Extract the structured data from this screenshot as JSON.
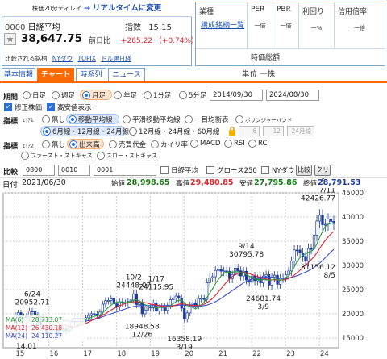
{
  "notice": {
    "small": "株価20分ディレイ",
    "arrow": "→",
    "big": "リアルタイムに変更"
  },
  "quote": {
    "code": "0000",
    "name": "日経平均",
    "index_label": "指数",
    "time": "15:15",
    "price": "38,647.75",
    "prev_label": "前日比",
    "change": "+285.22",
    "change_pct": "（+0.74%）",
    "compared_label": "比較される銘柄",
    "compared_links": [
      "NYダウ",
      "TOPIX",
      "ドル建日経"
    ]
  },
  "info": {
    "industry_label": "業種",
    "industry_value": "構成銘柄一覧",
    "per_label": "PER",
    "per_value": "一倍",
    "pbr_label": "PBR",
    "pbr_value": "一倍",
    "yield_label": "利回り",
    "yield_value": "一%",
    "credit_label": "信用倍率",
    "credit_value": "一倍",
    "mcap_label": "時価総額",
    "unit": "単位 一株"
  },
  "tabs": [
    "基本情報",
    "チャート",
    "時系列",
    "ニュース"
  ],
  "settings": {
    "period_label": "期間",
    "periods": [
      "日足",
      "週足",
      "月足",
      "年足",
      "1分足",
      "5分足"
    ],
    "selected_period": "月足",
    "date_from": "2014/09/30",
    "date_to": "2024/08/30",
    "adjusted_label": "修正株価",
    "highlow_label": "高安値表示",
    "indicator_label": "指標",
    "area1_label": "ｴﾘｱ1",
    "area1_opts": [
      "無し",
      "移動平均線",
      "平滑移動平均線",
      "一目均衡表",
      "ボリンジャーバンド"
    ],
    "ma_opts": [
      "6月線・12月線・24月線",
      "12月線・24月線・60月線"
    ],
    "ma_inputs": [
      "6",
      "12",
      "24月線"
    ],
    "area2_label": "ｴﾘｱ2",
    "area2_opts": [
      "無し",
      "出来高",
      "売買代金",
      "カイリ率",
      "MACD",
      "RSI",
      "RCI"
    ],
    "area2_opts_b": [
      "ファースト・ストキャス",
      "スロー・ストキャス"
    ],
    "compare_label": "比較",
    "compare_inputs": [
      "0800",
      "0010",
      "0001"
    ],
    "compare_checks": [
      "日経平均",
      "グロース250",
      "NYダウ"
    ],
    "compare_btn": "比較",
    "clear_btn": "クリア"
  },
  "header": {
    "date_label": "日付",
    "date": "2021/06/30",
    "open_label": "始値",
    "open": "28,998.65",
    "high_label": "高値",
    "high": "29,480.85",
    "low_label": "安値",
    "low": "27,795.86",
    "close_label": "終値",
    "close": "28,791.53"
  },
  "colors": {
    "up": "#1a7a1a",
    "high": "#e2242e",
    "down": "#1c3c99",
    "accent": "#ff6a00",
    "link": "#1c4fb1"
  },
  "chart_data": {
    "type": "candlestick",
    "x_ticks": [
      "15",
      "16",
      "17",
      "18",
      "19",
      "20",
      "21",
      "22",
      "23",
      "24"
    ],
    "ylim": [
      13000,
      45000
    ],
    "y_ticks": [
      15000,
      20000,
      25000,
      30000,
      35000,
      40000,
      45000
    ],
    "closes": [
      16173,
      17388,
      19747,
      20235,
      19034,
      19520,
      19207,
      20585,
      20563,
      19747,
      18890,
      17519,
      17518,
      16027,
      16759,
      16667,
      17235,
      15576,
      16569,
      16887,
      16450,
      17425,
      18308,
      19114,
      19041,
      19119,
      18909,
      19197,
      19651,
      20033,
      19925,
      19646,
      20356,
      22012,
      22725,
      22765,
      23098,
      22068,
      21454,
      22468,
      22202,
      22305,
      22554,
      22865,
      24120,
      21920,
      22351,
      20015,
      20773,
      21385,
      21206,
      22259,
      20601,
      21276,
      21522,
      20704,
      21756,
      22927,
      23294,
      23657,
      23205,
      21143,
      18917,
      20194,
      21878,
      22288,
      21710,
      23140,
      23185,
      22977,
      26434,
      27444,
      27663,
      28966,
      29179,
      28813,
      28860,
      28792,
      27284,
      28090,
      29453,
      28893,
      27822,
      28792,
      27002,
      26527,
      27821,
      26848,
      27279,
      26393,
      27801,
      28092,
      25937,
      27587,
      27969,
      26095,
      27327,
      27446,
      28041,
      28856,
      30888,
      33189,
      33172,
      32619,
      31858,
      30859,
      33486,
      33464,
      36287,
      39166,
      40369,
      38406,
      38488,
      39583,
      39101,
      38647
    ],
    "ma6": [
      16000,
      16500,
      17100,
      17700,
      18200,
      18700,
      19100,
      19400,
      19600,
      19800,
      19800,
      19600,
      19300,
      18700,
      18200,
      17900,
      17500,
      17000,
      16700,
      16600,
      16500,
      16600,
      16800,
      17300,
      17600,
      18000,
      18400,
      18700,
      19000,
      19300,
      19500,
      19600,
      19800,
      20200,
      20800,
      21300,
      21800,
      22200,
      22400,
      22500,
      22500,
      22300,
      22400,
      22500,
      22800,
      22900,
      22700,
      22300,
      21900,
      21600,
      21300,
      21400,
      21200,
      21300,
      21400,
      21300,
      21400,
      21700,
      22100,
      22500,
      22800,
      22800,
      22300,
      21700,
      21500,
      21300,
      21000,
      21400,
      21900,
      22400,
      23400,
      24300,
      25200,
      26200,
      27100,
      27800,
      28300,
      28700,
      28600,
      28600,
      28700,
      28700,
      28500,
      28500,
      28100,
      27800,
      27500,
      27200,
      27100,
      27000,
      27100,
      27100,
      26900,
      27000,
      27200,
      27100,
      26900,
      27100,
      27500,
      27800,
      28600,
      29700,
      30900,
      31600,
      32100,
      32400,
      32700,
      32900,
      33400,
      34400,
      35800,
      37000,
      38100,
      38500,
      38700,
      38800
    ],
    "ma12": [
      15800,
      16100,
      16500,
      17000,
      17400,
      17800,
      18200,
      18600,
      18900,
      19200,
      19400,
      19500,
      19500,
      19400,
      19200,
      18900,
      18600,
      18300,
      18000,
      17800,
      17600,
      17400,
      17200,
      17300,
      17400,
      17600,
      17800,
      18000,
      18300,
      18600,
      18900,
      19200,
      19400,
      19700,
      20000,
      20400,
      20800,
      21100,
      21400,
      21700,
      21900,
      22100,
      22300,
      22400,
      22500,
      22500,
      22500,
      22400,
      22300,
      22200,
      22000,
      21900,
      21800,
      21700,
      21600,
      21500,
      21500,
      21500,
      21600,
      21800,
      22000,
      22100,
      22000,
      21900,
      21800,
      21700,
      21700,
      21700,
      21800,
      22000,
      22300,
      22700,
      23200,
      23800,
      24500,
      25200,
      25900,
      26600,
      27200,
      27700,
      28100,
      28400,
      28500,
      28600,
      28400,
      28300,
      28100,
      27900,
      27700,
      27500,
      27300,
      27200,
      27100,
      27000,
      27000,
      27000,
      27000,
      27000,
      27100,
      27300,
      27600,
      28000,
      28500,
      29000,
      29600,
      30100,
      30600,
      31200,
      31800,
      32600,
      33500,
      34400,
      35200,
      35900,
      36500,
      37000
    ],
    "ma24": [
      15400,
      15600,
      15800,
      16100,
      16400,
      16700,
      17000,
      17300,
      17600,
      17900,
      18200,
      18400,
      18600,
      18700,
      18800,
      18900,
      18900,
      18900,
      18800,
      18700,
      18600,
      18500,
      18400,
      18400,
      18400,
      18400,
      18400,
      18500,
      18600,
      18700,
      18800,
      19000,
      19200,
      19400,
      19600,
      19800,
      20000,
      20200,
      20400,
      20600,
      20800,
      21000,
      21200,
      21400,
      21500,
      21600,
      21700,
      21700,
      21700,
      21700,
      21700,
      21700,
      21700,
      21700,
      21700,
      21700,
      21700,
      21700,
      21700,
      21700,
      21800,
      21800,
      21800,
      21700,
      21700,
      21600,
      21600,
      21600,
      21600,
      21700,
      21800,
      22000,
      22200,
      22500,
      22800,
      23200,
      23600,
      24000,
      24400,
      24800,
      25200,
      25600,
      26000,
      26400,
      26700,
      27000,
      27200,
      27400,
      27500,
      27600,
      27600,
      27600,
      27500,
      27500,
      27400,
      27400,
      27300,
      27300,
      27300,
      27400,
      27500,
      27700,
      27900,
      28100,
      28400,
      28600,
      28900,
      29200,
      29600,
      30000,
      30500,
      31000,
      31600,
      32200,
      32800,
      33300
    ],
    "annotations": [
      {
        "label": "6/24",
        "value": "20952.71",
        "i": 8,
        "y": 20952.71,
        "pos": "above"
      },
      {
        "label": "10/2",
        "value": "24448.07",
        "i": 44,
        "y": 24448.07,
        "pos": "above"
      },
      {
        "label": "12/26",
        "value": "18948.58",
        "i": 47,
        "y": 18948.58,
        "pos": "below"
      },
      {
        "label": "1/17",
        "value": "24115.95",
        "i": 52,
        "y": 24115.95,
        "pos": "above"
      },
      {
        "label": "3/19",
        "value": "16358.19",
        "i": 62,
        "y": 16358.19,
        "pos": "below"
      },
      {
        "label": "9/14",
        "value": "30795.78",
        "i": 84,
        "y": 30795.78,
        "pos": "above"
      },
      {
        "label": "3/9",
        "value": "24681.74",
        "i": 90,
        "y": 24681.74,
        "pos": "below"
      },
      {
        "label": "7/11",
        "value": "42426.77",
        "i": 117,
        "y": 42426.77,
        "pos": "above"
      },
      {
        "label": "8/5",
        "value": "31156.12",
        "i": 118,
        "y": 31156.12,
        "pos": "below"
      },
      {
        "label": "",
        "value": "14.01",
        "i": 4,
        "y": 14864,
        "pos": "below"
      }
    ],
    "legend": [
      {
        "name": "MA(6)",
        "value": "28,713.07",
        "color": "#2e9e3a"
      },
      {
        "name": "MA(12)",
        "value": "26,430.18",
        "color": "#e2242e"
      },
      {
        "name": "MA(24)",
        "value": "24,110.27",
        "color": "#3b4fd0"
      }
    ]
  }
}
